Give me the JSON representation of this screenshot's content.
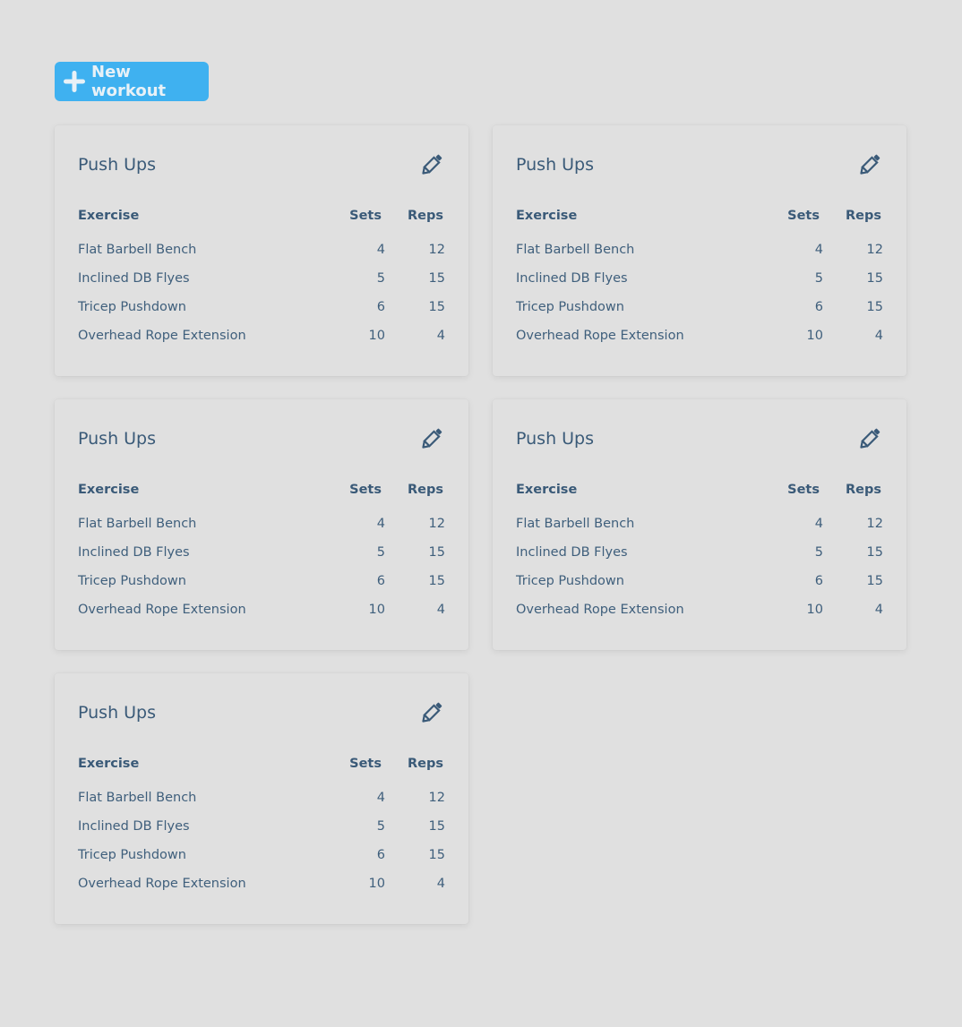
{
  "toolbar": {
    "new_label": "New workout"
  },
  "colors": {
    "background": "#e0e0e0",
    "accent": "#3fb1f0",
    "text": "#3a5a78"
  },
  "workouts": [
    {
      "title": "Push Ups",
      "headers": {
        "exercise": "Exercise",
        "sets": "Sets",
        "reps": "Reps"
      },
      "rows": [
        {
          "exercise": "Flat Barbell Bench",
          "sets": "4",
          "reps": "12"
        },
        {
          "exercise": "Inclined DB Flyes",
          "sets": "5",
          "reps": "15"
        },
        {
          "exercise": "Tricep Pushdown",
          "sets": "6",
          "reps": "15"
        },
        {
          "exercise": "Overhead Rope Extension",
          "sets": "10",
          "reps": "4"
        }
      ]
    },
    {
      "title": "Push Ups",
      "headers": {
        "exercise": "Exercise",
        "sets": "Sets",
        "reps": "Reps"
      },
      "rows": [
        {
          "exercise": "Flat Barbell Bench",
          "sets": "4",
          "reps": "12"
        },
        {
          "exercise": "Inclined DB Flyes",
          "sets": "5",
          "reps": "15"
        },
        {
          "exercise": "Tricep Pushdown",
          "sets": "6",
          "reps": "15"
        },
        {
          "exercise": "Overhead Rope Extension",
          "sets": "10",
          "reps": "4"
        }
      ]
    },
    {
      "title": "Push Ups",
      "headers": {
        "exercise": "Exercise",
        "sets": "Sets",
        "reps": "Reps"
      },
      "rows": [
        {
          "exercise": "Flat Barbell Bench",
          "sets": "4",
          "reps": "12"
        },
        {
          "exercise": "Inclined DB Flyes",
          "sets": "5",
          "reps": "15"
        },
        {
          "exercise": "Tricep Pushdown",
          "sets": "6",
          "reps": "15"
        },
        {
          "exercise": "Overhead Rope Extension",
          "sets": "10",
          "reps": "4"
        }
      ]
    },
    {
      "title": "Push Ups",
      "headers": {
        "exercise": "Exercise",
        "sets": "Sets",
        "reps": "Reps"
      },
      "rows": [
        {
          "exercise": "Flat Barbell Bench",
          "sets": "4",
          "reps": "12"
        },
        {
          "exercise": "Inclined DB Flyes",
          "sets": "5",
          "reps": "15"
        },
        {
          "exercise": "Tricep Pushdown",
          "sets": "6",
          "reps": "15"
        },
        {
          "exercise": "Overhead Rope Extension",
          "sets": "10",
          "reps": "4"
        }
      ]
    },
    {
      "title": "Push Ups",
      "headers": {
        "exercise": "Exercise",
        "sets": "Sets",
        "reps": "Reps"
      },
      "rows": [
        {
          "exercise": "Flat Barbell Bench",
          "sets": "4",
          "reps": "12"
        },
        {
          "exercise": "Inclined DB Flyes",
          "sets": "5",
          "reps": "15"
        },
        {
          "exercise": "Tricep Pushdown",
          "sets": "6",
          "reps": "15"
        },
        {
          "exercise": "Overhead Rope Extension",
          "sets": "10",
          "reps": "4"
        }
      ]
    }
  ]
}
